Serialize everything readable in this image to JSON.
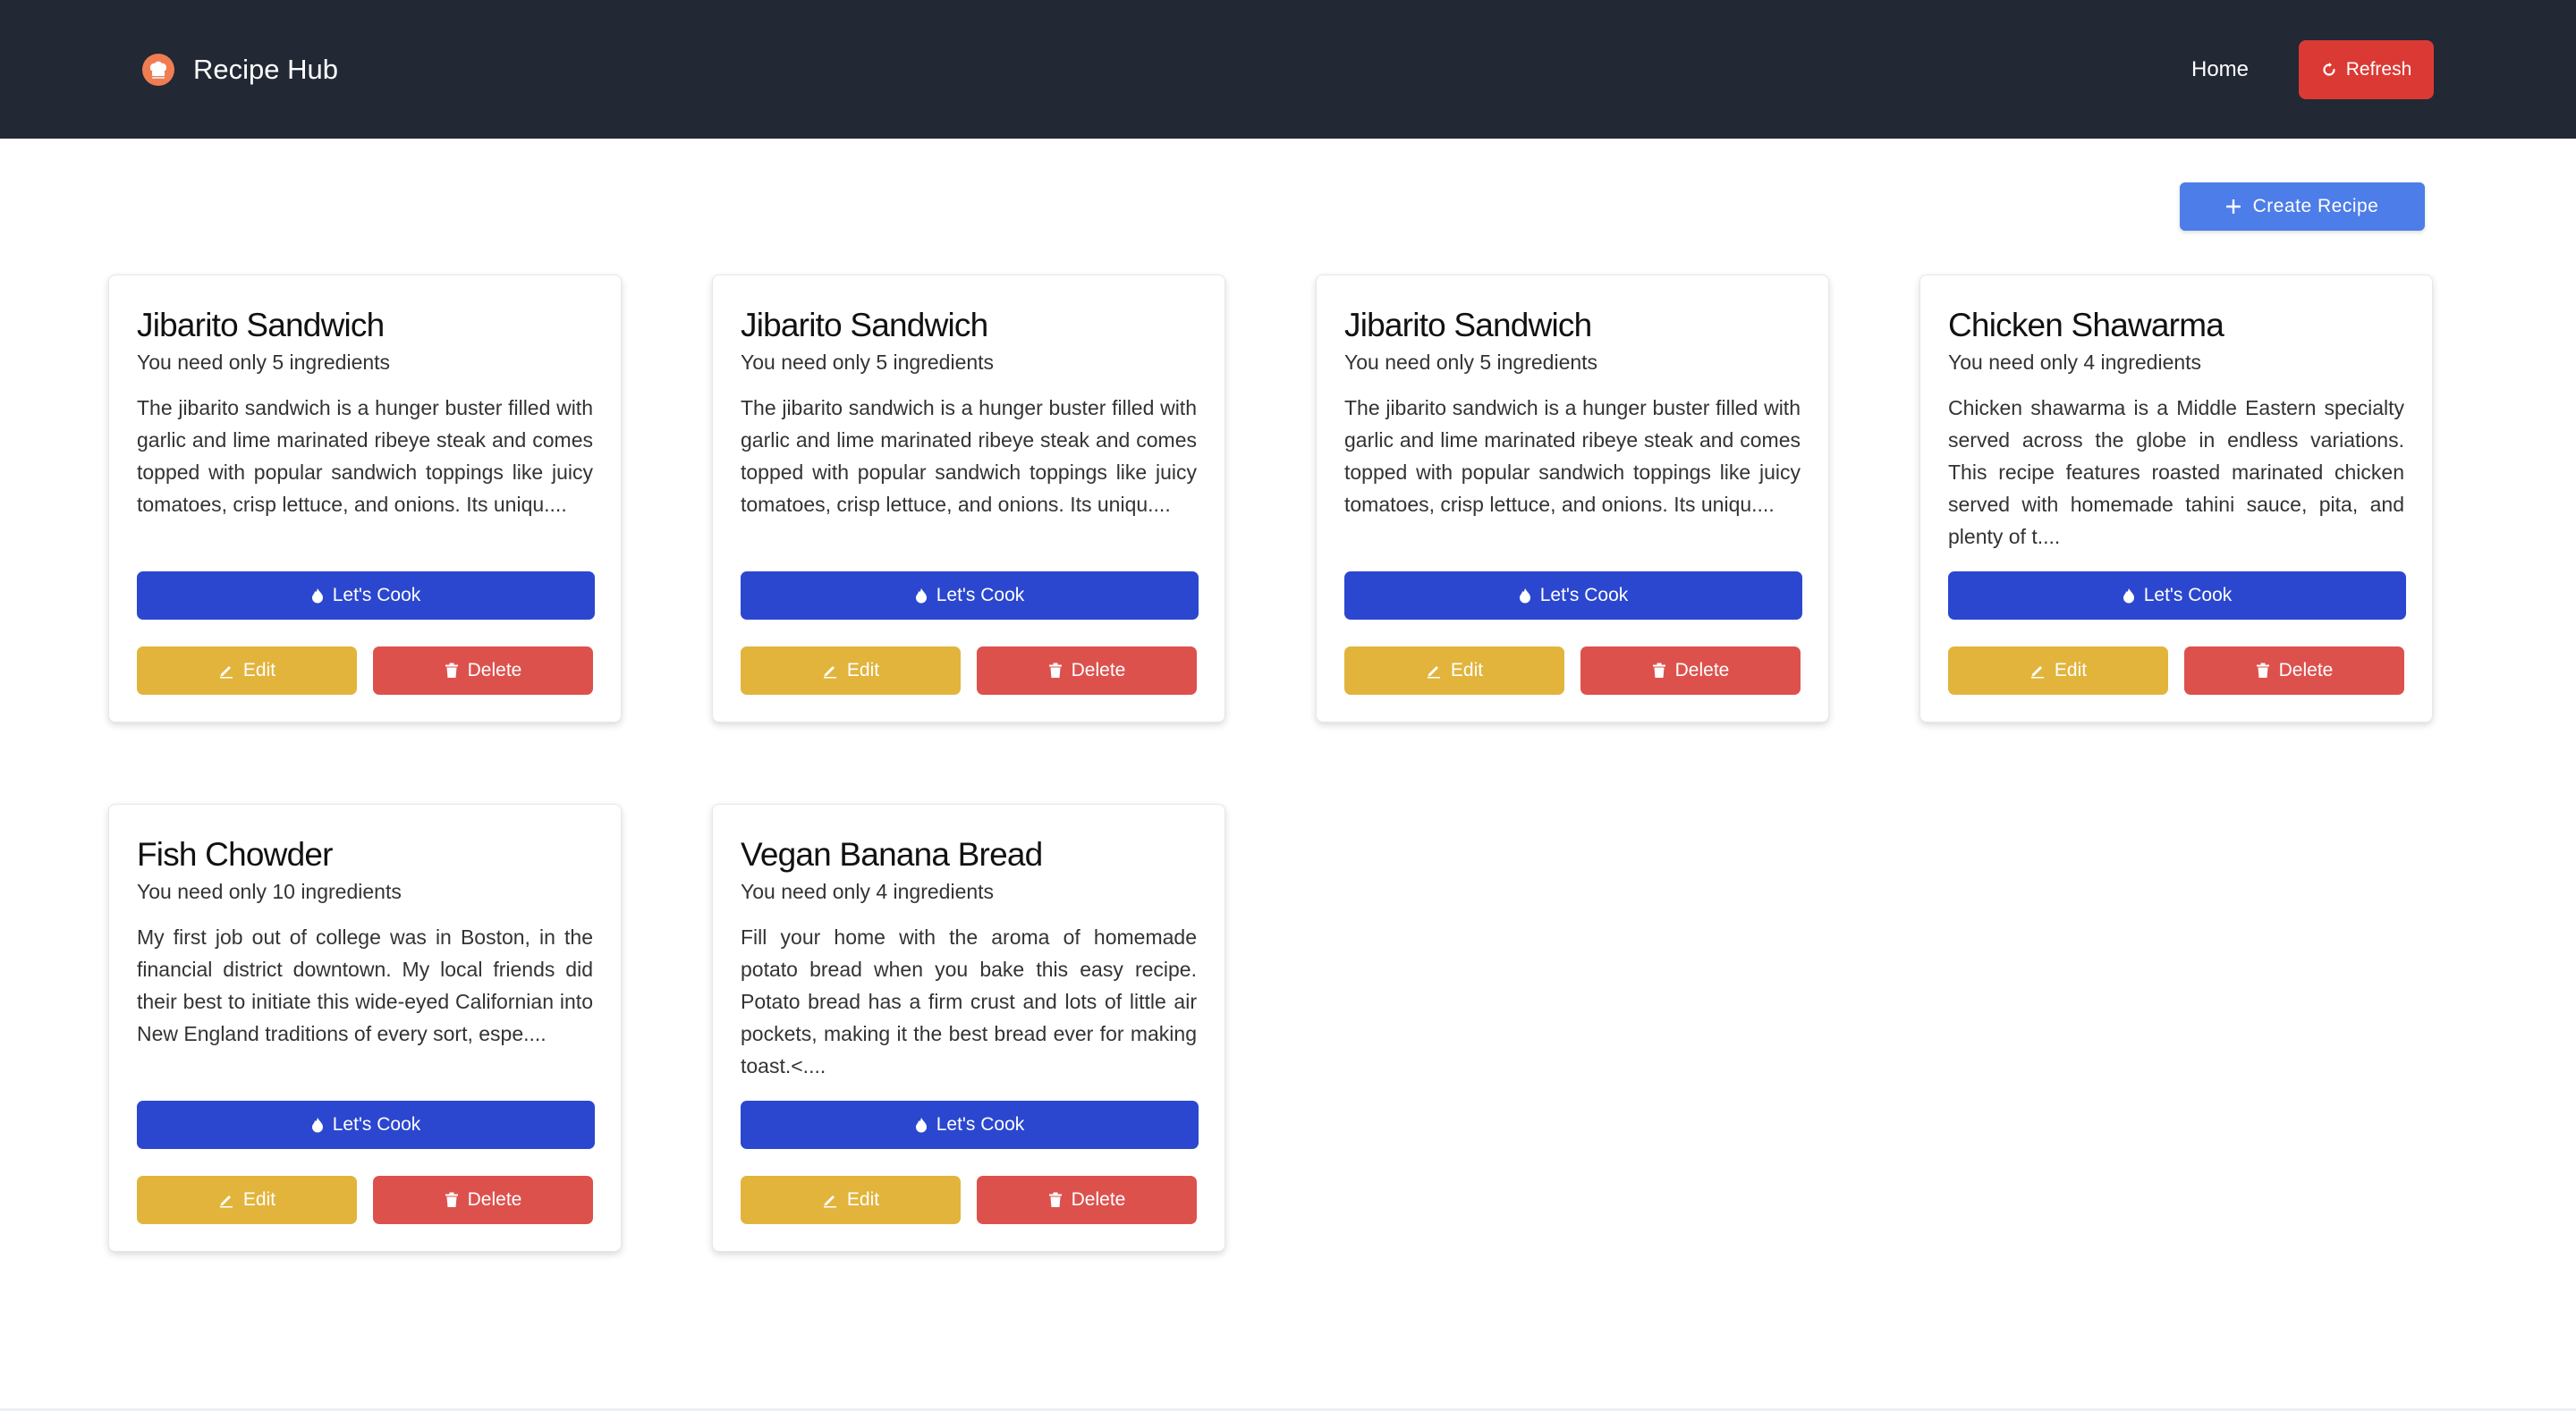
{
  "nav": {
    "brand": "Recipe Hub",
    "home": "Home",
    "refresh": "Refresh"
  },
  "toolbar": {
    "create": "Create Recipe"
  },
  "cards": [
    {
      "title": "Jibarito Sandwich",
      "ingredients": "You need only 5 ingredients",
      "description": "The jibarito sandwich is a hunger buster filled with garlic and lime marinated ribeye steak and comes topped with popular sandwich toppings like juicy tomatoes, crisp lettuce, and onions. Its uniqu....",
      "cook": "Let's Cook",
      "edit": "Edit",
      "delete": "Delete"
    },
    {
      "title": "Jibarito Sandwich",
      "ingredients": "You need only 5 ingredients",
      "description": "The jibarito sandwich is a hunger buster filled with garlic and lime marinated ribeye steak and comes topped with popular sandwich toppings like juicy tomatoes, crisp lettuce, and onions. Its uniqu....",
      "cook": "Let's Cook",
      "edit": "Edit",
      "delete": "Delete"
    },
    {
      "title": "Jibarito Sandwich",
      "ingredients": "You need only 5 ingredients",
      "description": "The jibarito sandwich is a hunger buster filled with garlic and lime marinated ribeye steak and comes topped with popular sandwich toppings like juicy tomatoes, crisp lettuce, and onions. Its uniqu....",
      "cook": "Let's Cook",
      "edit": "Edit",
      "delete": "Delete"
    },
    {
      "title": "Chicken Shawarma",
      "ingredients": "You need only 4 ingredients",
      "description": "Chicken shawarma is a Middle Eastern specialty served across the globe in endless variations. This recipe features roasted marinated chicken served with homemade tahini sauce, pita, and plenty of t....",
      "cook": "Let's Cook",
      "edit": "Edit",
      "delete": "Delete"
    },
    {
      "title": "Fish Chowder",
      "ingredients": "You need only 10 ingredients",
      "description": "My first job out of college was in Boston, in the financial district downtown. My local friends did their best to initiate this wide-eyed Californian into New England traditions of every sort, espe....",
      "cook": "Let's Cook",
      "edit": "Edit",
      "delete": "Delete"
    },
    {
      "title": "Vegan Banana Bread",
      "ingredients": "You need only 4 ingredients",
      "description": "Fill your home with the aroma of homemade potato bread when you bake this easy recipe. Potato bread has a firm crust and lots of little air pockets, making it the best bread ever for making toast.<....",
      "cook": "Let's Cook",
      "edit": "Edit",
      "delete": "Delete"
    }
  ],
  "colors": {
    "navbar": "#222834",
    "refresh": "#db3a34",
    "create": "#4d7de8",
    "cook": "#2b47cf",
    "edit": "#e2b43c",
    "delete": "#dd514d"
  },
  "icons": {
    "brand": "chef-hat-icon",
    "refresh": "refresh-icon",
    "create": "plus-icon",
    "cook": "flame-icon",
    "edit": "pencil-icon",
    "delete": "trash-icon"
  }
}
